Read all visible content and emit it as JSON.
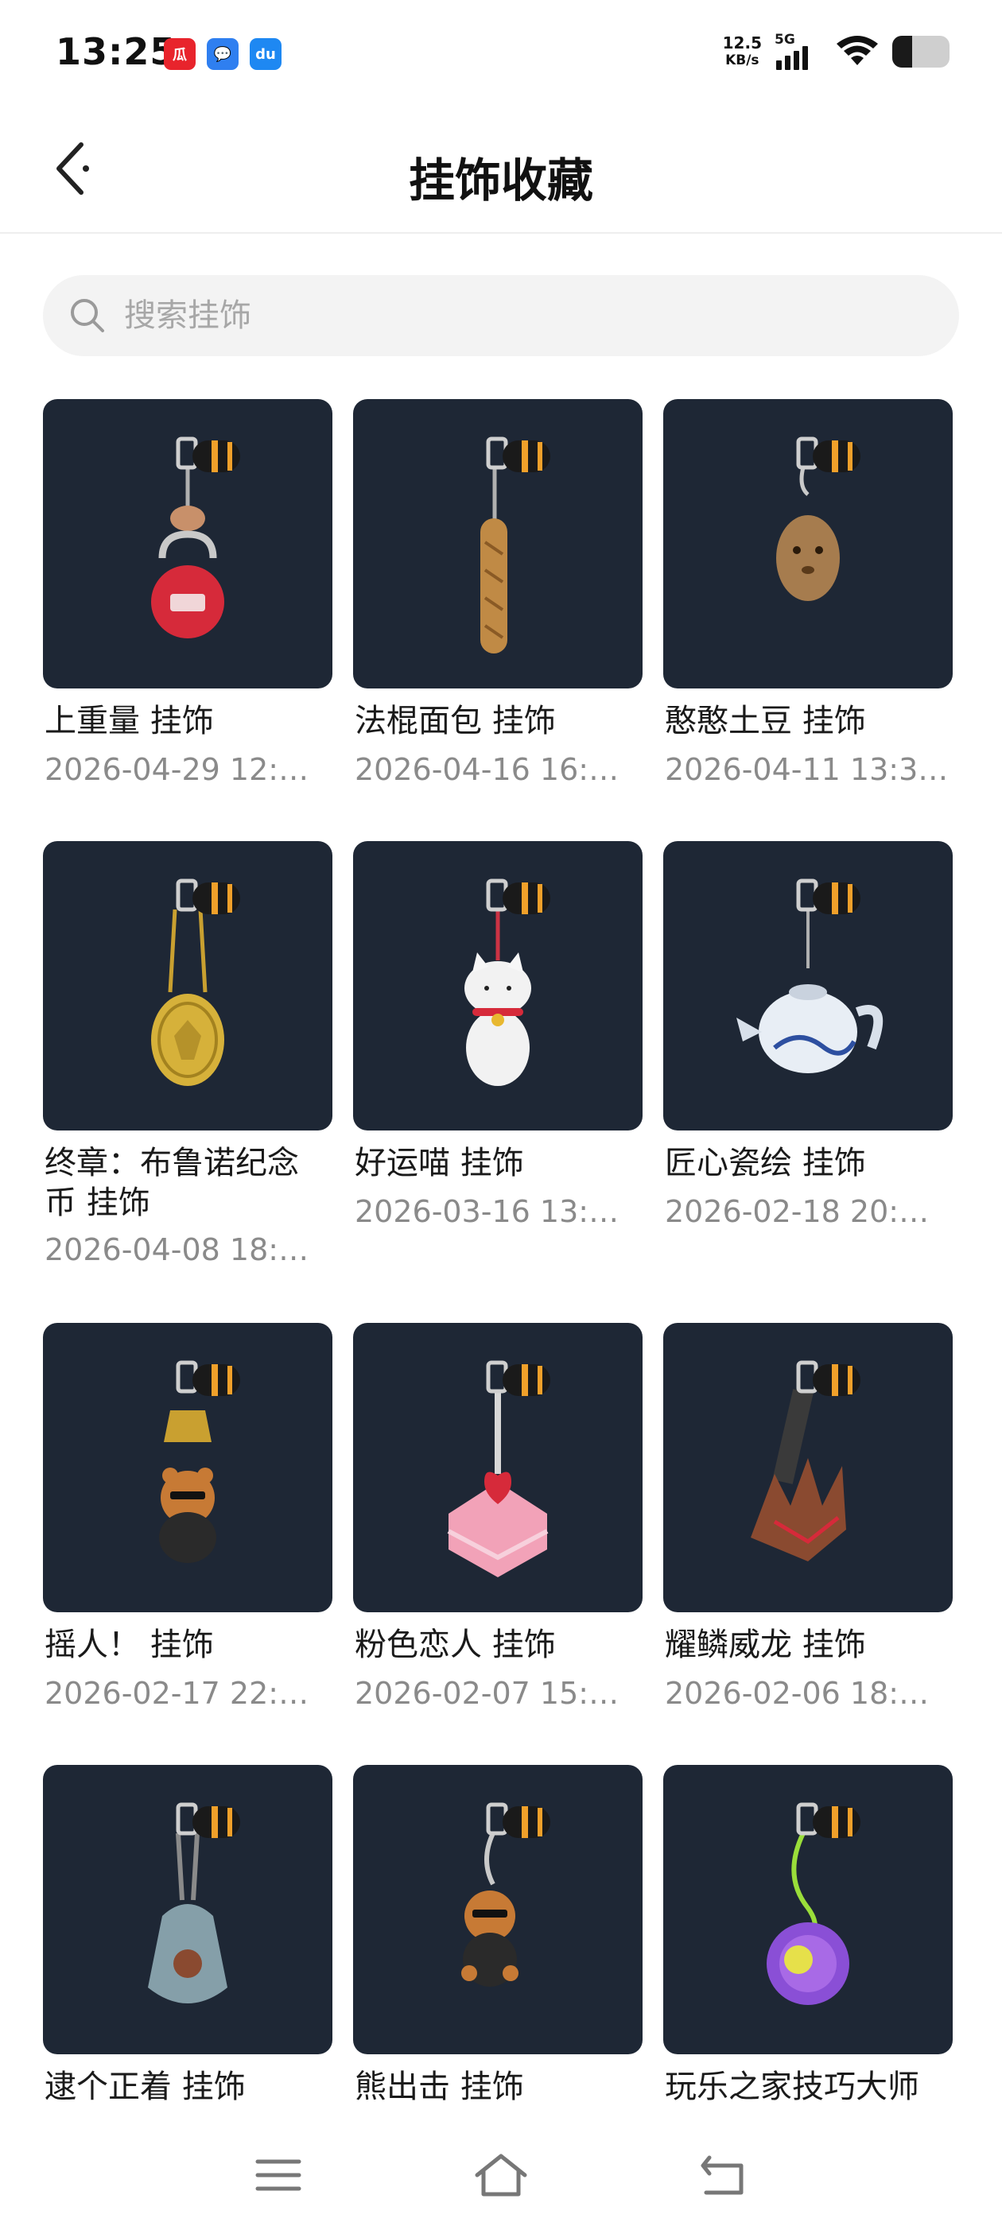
{
  "status_bar": {
    "time": "13:25",
    "notification_icons": [
      {
        "name": "app-notification-icon-1",
        "color": "#e8242c",
        "glyph": "瓜"
      },
      {
        "name": "message-notification-icon",
        "color": "#2f7ff0",
        "glyph": "💬"
      },
      {
        "name": "du-notification-icon",
        "color": "#1e88f2",
        "glyph": "du"
      }
    ],
    "net_speed_value": "12.5",
    "net_speed_unit": "KB/s",
    "network_type": "5G",
    "battery_level": 0.35
  },
  "header": {
    "title": "挂饰收藏"
  },
  "search": {
    "placeholder": "搜索挂饰",
    "value": ""
  },
  "items": [
    {
      "title": "上重量 挂饰",
      "date": "2026-04-29 12:…",
      "charm": "kettlebell",
      "accent": "#d62a3a"
    },
    {
      "title": "法棍面包 挂饰",
      "date": "2026-04-16 16:…",
      "charm": "baguette",
      "accent": "#c08a45"
    },
    {
      "title": "憨憨土豆 挂饰",
      "date": "2026-04-11 13:3…",
      "charm": "potato",
      "accent": "#a67c4e"
    },
    {
      "title": "终章：布鲁诺纪念币 挂饰",
      "date": "2026-04-08 18:…",
      "charm": "coin",
      "accent": "#d6b13a"
    },
    {
      "title": "好运喵 挂饰",
      "date": "2026-03-16 13:…",
      "charm": "lucky-cat",
      "accent": "#f2f2f2"
    },
    {
      "title": "匠心瓷绘 挂饰",
      "date": "2026-02-18 20:…",
      "charm": "teapot",
      "accent": "#e8eef5"
    },
    {
      "title": "摇人！ 挂饰",
      "date": "2026-02-17 22:…",
      "charm": "bell-bear",
      "accent": "#c77a35"
    },
    {
      "title": "粉色恋人 挂饰",
      "date": "2026-02-07 15:…",
      "charm": "cake",
      "accent": "#f2a2b8"
    },
    {
      "title": "耀鳞威龙 挂饰",
      "date": "2026-02-06 18:…",
      "charm": "dragon-claw",
      "accent": "#8a4a30"
    },
    {
      "title": "逮个正着 挂饰",
      "date": "",
      "charm": "bag",
      "accent": "#a8c8d0"
    },
    {
      "title": "熊出击 挂饰",
      "date": "",
      "charm": "bear",
      "accent": "#c77a35"
    },
    {
      "title": "玩乐之家技巧大师",
      "date": "",
      "charm": "yoyo",
      "accent": "#8a4fd6"
    }
  ],
  "nav": {
    "menu": "menu-icon",
    "home": "home-icon",
    "back": "back-icon"
  }
}
